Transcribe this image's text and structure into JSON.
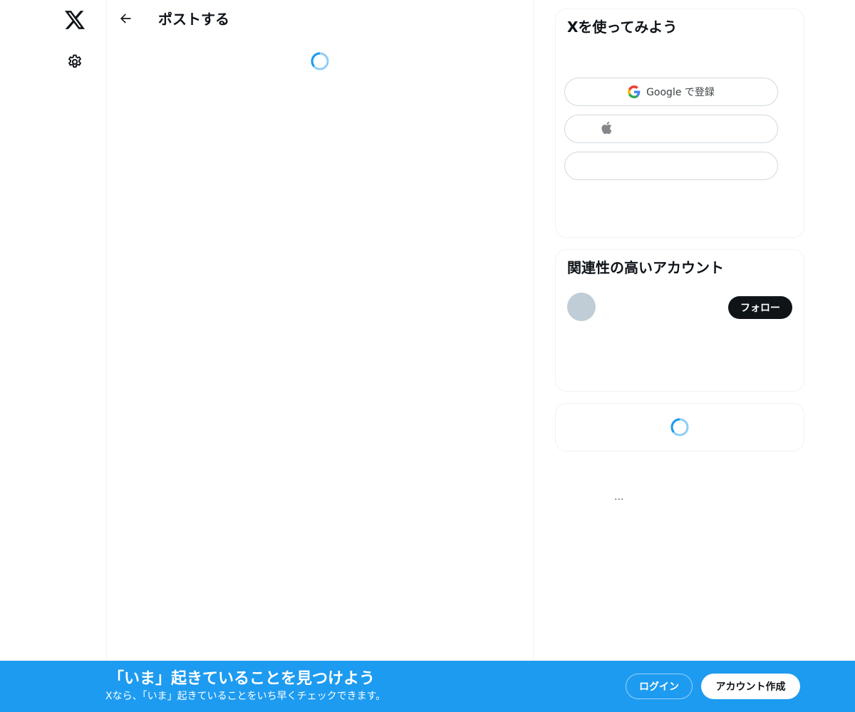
{
  "nav": {
    "logo_icon": "x-logo-icon",
    "settings_icon": "gear-icon"
  },
  "header": {
    "back_icon": "arrow-left-icon",
    "title": "ポストする"
  },
  "signup_card": {
    "title": "Xを使ってみよう",
    "google_label": "Google で登録",
    "apple_label": "",
    "create_label": ""
  },
  "related_card": {
    "title": "関連性の高いアカウント",
    "follow_label": "フォロー"
  },
  "more": {
    "label": "..."
  },
  "bottom_bar": {
    "heading": "「いま」起きていることを見つけよう",
    "subtext": "Xなら、「いま」起きていることをいち早くチェックできます。",
    "login_label": "ログイン",
    "signup_label": "アカウント作成"
  },
  "colors": {
    "accent": "#1d9bf0",
    "text": "#0f1419",
    "border": "#eff3f4",
    "avatar_placeholder": "#c0cdd6"
  }
}
